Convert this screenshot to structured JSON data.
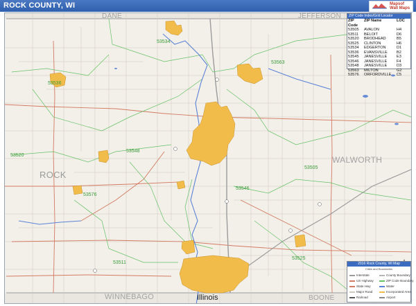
{
  "title": "ROCK COUNTY, WI",
  "logo": {
    "text_top": "Mapsof",
    "text_bottom": "Wall Maps"
  },
  "neighbors": {
    "north_west": "DANE",
    "north_east": "JEFFERSON",
    "east": "WALWORTH",
    "center": "ROCK",
    "south_west": "WINNEBAGO",
    "south_center": "Illinois",
    "south_east": "BOONE"
  },
  "zip_labels": [
    "53534",
    "53563",
    "53536",
    "53520",
    "53548",
    "53505",
    "53576",
    "53546",
    "53525",
    "53511"
  ],
  "zip_table": {
    "header": "ZIP Code Index/Grid Locator",
    "columns": [
      "ZIP Code",
      "ZIP Name",
      "LOC"
    ],
    "rows": [
      [
        "53505",
        "AVALON",
        "H4"
      ],
      [
        "53511",
        "BELOIT",
        "D6"
      ],
      [
        "53520",
        "BRODHEAD",
        "B5"
      ],
      [
        "53525",
        "CLINTON",
        "H6"
      ],
      [
        "53534",
        "EDGERTON",
        "D1"
      ],
      [
        "53536",
        "EVANSVILLE",
        "B2"
      ],
      [
        "53545",
        "JANESVILLE",
        "E3"
      ],
      [
        "53546",
        "JANESVILLE",
        "F4"
      ],
      [
        "53548",
        "JANESVILLE",
        "D3"
      ],
      [
        "53563",
        "MILTON",
        "G2"
      ],
      [
        "53576",
        "ORFORDVILLE",
        "C5"
      ]
    ]
  },
  "legend": {
    "title": "2016 Rock County, WI Map",
    "subtitle": "Cities and Boundaries",
    "items_left": [
      "Interstate",
      "US Highway",
      "State Hwy",
      "Major Road",
      "Railroad"
    ],
    "items_right": [
      "County Boundary",
      "ZIP Code Boundary",
      "Water",
      "Incorporated Area",
      "Airport"
    ]
  },
  "colors": {
    "title_bar": "#2f5fae",
    "map_bg": "#f2f0e9",
    "urban": "#f2bc4a",
    "zip_boundary": "#66c066",
    "road": "#d37a63",
    "water": "#5b82d6",
    "county_label": "#a3a3a3"
  }
}
